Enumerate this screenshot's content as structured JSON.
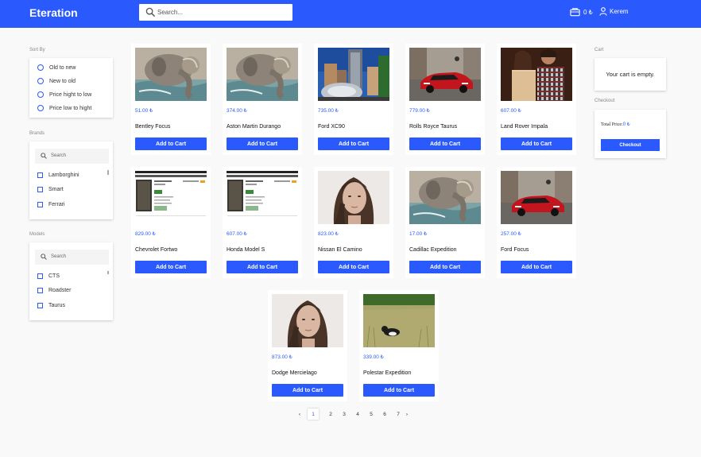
{
  "header": {
    "logo": "Eteration",
    "search_placeholder": "Search...",
    "cart_total": "0 ₺",
    "user_name": "Kerem"
  },
  "sort": {
    "title": "Sort By",
    "options": [
      "Old to new",
      "New to old",
      "Price hight to low",
      "Price low to hight"
    ]
  },
  "brands": {
    "title": "Brands",
    "search_placeholder": "Search",
    "items": [
      "Lamborghini",
      "Smart",
      "Ferrari"
    ]
  },
  "models": {
    "title": "Models",
    "search_placeholder": "Search",
    "items": [
      "CTS",
      "Roadster",
      "Taurus"
    ]
  },
  "products": [
    {
      "price": "51.00 ₺",
      "name": "Bentley Focus",
      "image": "elephant",
      "button": "Add to Cart"
    },
    {
      "price": "374.00 ₺",
      "name": "Aston Martin Durango",
      "image": "elephant",
      "button": "Add to Cart"
    },
    {
      "price": "735.00 ₺",
      "name": "Ford XC90",
      "image": "city",
      "button": "Add to Cart"
    },
    {
      "price": "779.00 ₺",
      "name": "Rolls Royce Taurus",
      "image": "red-car",
      "button": "Add to Cart"
    },
    {
      "price": "607.00 ₺",
      "name": "Land Rover Impala",
      "image": "couple",
      "button": "Add to Cart"
    },
    {
      "price": "829.00 ₺",
      "name": "Chevrolet Fortwo",
      "image": "webpage",
      "button": "Add to Cart"
    },
    {
      "price": "607.00 ₺",
      "name": "Honda Model S",
      "image": "webpage",
      "button": "Add to Cart"
    },
    {
      "price": "823.00 ₺",
      "name": "Nissan El Camino",
      "image": "woman",
      "button": "Add to Cart"
    },
    {
      "price": "17.00 ₺",
      "name": "Cadillac Expedition",
      "image": "elephant",
      "button": "Add to Cart"
    },
    {
      "price": "257.00 ₺",
      "name": "Ford Focus",
      "image": "red-car",
      "button": "Add to Cart"
    },
    {
      "price": "873.00 ₺",
      "name": "Dodge Mercielago",
      "image": "woman",
      "button": "Add to Cart"
    },
    {
      "price": "339.00 ₺",
      "name": "Polestar Expedition",
      "image": "cat-field",
      "button": "Add to Cart"
    }
  ],
  "cart": {
    "title": "Cart",
    "empty_text": "Your cart is empty."
  },
  "checkout": {
    "title": "Checkout",
    "total_label": "Total Price:",
    "total_value": "0 ₺",
    "button": "Checkout"
  },
  "pagination": {
    "prev": "‹",
    "next": "›",
    "pages": [
      "1",
      "2",
      "3",
      "4",
      "5",
      "6",
      "7"
    ],
    "current": "1"
  },
  "colors": {
    "accent": "#2a59fe",
    "background": "#f9f9f9"
  }
}
